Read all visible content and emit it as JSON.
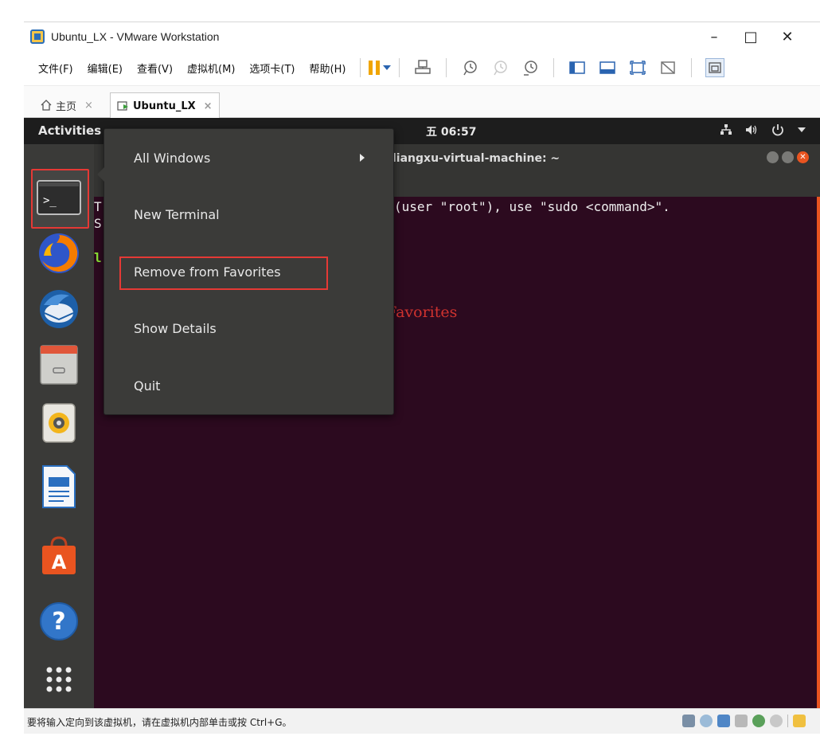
{
  "window": {
    "title": "Ubuntu_LX - VMware Workstation",
    "minimize": "–",
    "maximize": "□",
    "close": "✕"
  },
  "menubar": {
    "items": [
      "文件(F)",
      "编辑(E)",
      "查看(V)",
      "虚拟机(M)",
      "选项卡(T)",
      "帮助(H)"
    ]
  },
  "tabs": {
    "home": "主页",
    "vm": "Ubuntu_LX",
    "close_glyph": "×"
  },
  "ubuntu": {
    "activities": "Activities",
    "clock": "五 06:57",
    "terminal_title": "liangxu-virtual-machine: ~",
    "terminal_lines": [
      {
        "prefix": "T",
        "text": "(user \"root\"), use \"sudo <command>\"."
      },
      {
        "prefix": "S",
        "text": ""
      },
      {
        "prefix": "l",
        "text": ""
      }
    ],
    "annotation": "原本是Add to Favorites"
  },
  "context_menu": {
    "items": [
      "All Windows",
      "New Terminal",
      "Remove from Favorites",
      "Show Details",
      "Quit"
    ]
  },
  "statusbar": {
    "text": "要将输入定向到该虚拟机，请在虚拟机内部单击或按 Ctrl+G。"
  },
  "colors": {
    "terminal_bg": "#2c0a1f",
    "highlight_red": "#e53935",
    "ubuntu_orange": "#e95420",
    "annotation_red": "#d0332f"
  },
  "dock_icons": [
    "terminal-icon",
    "firefox-icon",
    "thunderbird-icon",
    "files-icon",
    "rhythmbox-icon",
    "libreoffice-writer-icon",
    "software-center-icon",
    "help-icon",
    "show-apps-icon"
  ]
}
